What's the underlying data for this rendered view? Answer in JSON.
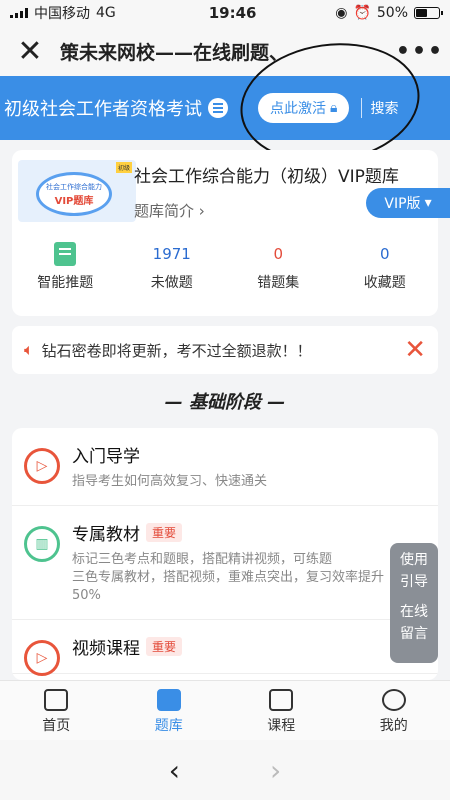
{
  "status": {
    "carrier": "中国移动",
    "network": "4G",
    "time": "19:46",
    "battery": "50%",
    "battery_level": 0.5
  },
  "navbar": {
    "title": "策未来网校——在线刷题、",
    "close_icon": "close-icon",
    "more_icon": "more-icon"
  },
  "header": {
    "exam_title": "初级社会工作者资格考试",
    "activate_label": "点此激活",
    "search_label": "搜索"
  },
  "bank": {
    "cover_line1": "社会工作综合能力",
    "cover_line2": "VIP题库",
    "cover_badge": "初级",
    "name": "社会工作综合能力（初级）VIP题库",
    "intro": "题库简介",
    "vip_label": "VIP版",
    "stats": [
      {
        "label": "智能推题",
        "value": ""
      },
      {
        "label": "未做题",
        "value": "1971"
      },
      {
        "label": "错题集",
        "value": "0"
      },
      {
        "label": "收藏题",
        "value": "0"
      }
    ]
  },
  "notice": {
    "text": "钻石密卷即将更新，考不过全额退款！！"
  },
  "section_title": "— 基础阶段 —",
  "courses": [
    {
      "name": "入门导学",
      "tag": "",
      "desc1": "指导考生如何高效复习、快速通关",
      "desc2": "",
      "desc3": ""
    },
    {
      "name": "专属教材",
      "tag": "重要",
      "desc1": "标记三色考点和题眼，搭配精讲视频，可练题",
      "desc2": "三色专属教材，搭配视频，重难点突出，复习效率提升",
      "desc3": "50%"
    },
    {
      "name": "视频课程",
      "tag": "重要",
      "desc1": "",
      "desc2": "",
      "desc3": ""
    }
  ],
  "help": {
    "line1": "使用",
    "line2": "引导",
    "line3": "在线",
    "line4": "留言"
  },
  "tabs": [
    {
      "label": "首页",
      "icon": "home-icon"
    },
    {
      "label": "题库",
      "icon": "question-bank-icon"
    },
    {
      "label": "课程",
      "icon": "tv-icon"
    },
    {
      "label": "我的",
      "icon": "profile-icon"
    }
  ],
  "browser": {
    "back": "‹",
    "forward": "›"
  }
}
